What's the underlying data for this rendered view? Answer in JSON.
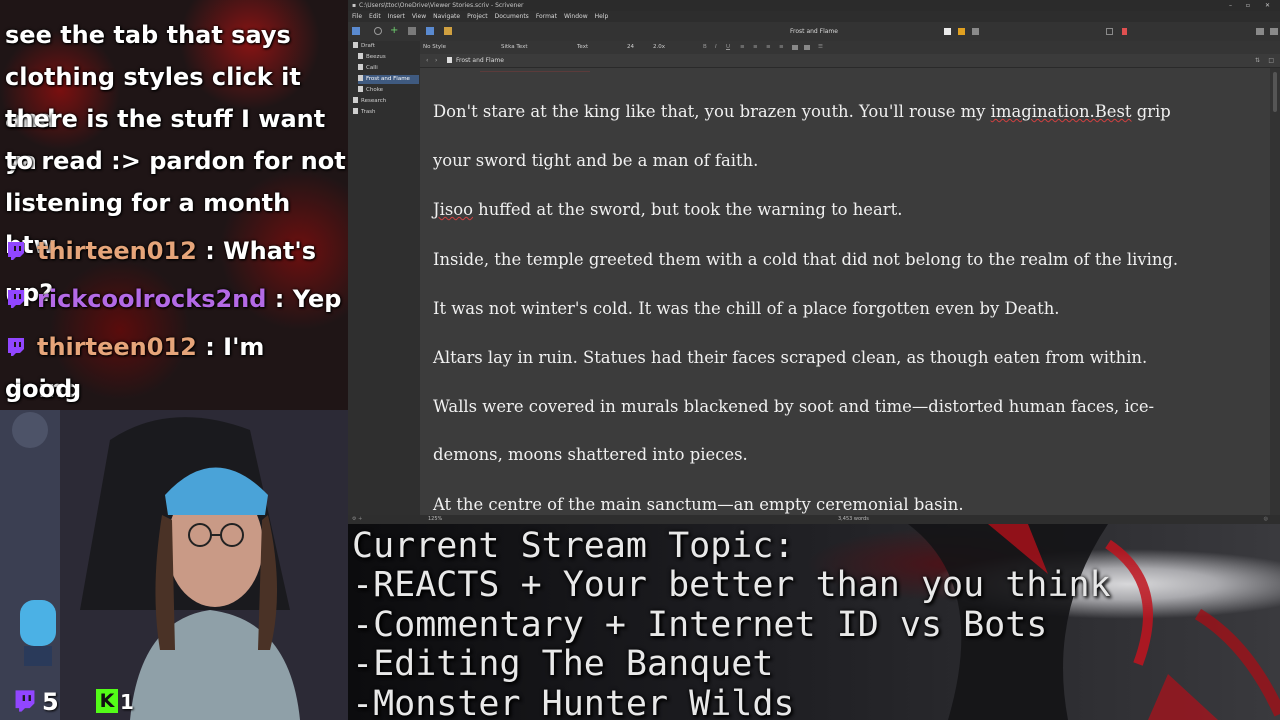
{
  "chat": {
    "messages": [
      {
        "text": "see the tab that says"
      },
      {
        "text": "clothing styles click it and"
      },
      {
        "text": "there is the stuff I want ya"
      },
      {
        "text": "to read :> pardon for not"
      },
      {
        "text": "listening for a month btw"
      },
      {
        "user": "thirteen012",
        "sep": " : ",
        "text": "What's up?"
      },
      {
        "user": "rickcoolrocks2nd",
        "sep": " : ",
        "text": "Yep"
      },
      {
        "user": "thirteen012",
        "sep": " : ",
        "text": "I'm doing"
      },
      {
        "text": "good"
      }
    ]
  },
  "badges": {
    "twitch_count": "5",
    "kick_count": "1"
  },
  "scrivener": {
    "window_title": "C:\\Users\\ttoc\\OneDrive\\Viewer Stories.scriv - Scrivener",
    "menu": [
      "File",
      "Edit",
      "Insert",
      "View",
      "Navigate",
      "Project",
      "Documents",
      "Format",
      "Window",
      "Help"
    ],
    "toolbar_doc_title": "Frost and Flame",
    "binder": [
      {
        "label": "Draft",
        "indent": 0
      },
      {
        "label": "Beezus",
        "indent": 1
      },
      {
        "label": "Calli",
        "indent": 1
      },
      {
        "label": "Frost and Flame",
        "indent": 1,
        "selected": true
      },
      {
        "label": "Choke",
        "indent": 1
      },
      {
        "label": "Research",
        "indent": 0
      },
      {
        "label": "Trash",
        "indent": 0
      }
    ],
    "format": {
      "style": "No Style",
      "font": "Sitka Text",
      "face": "Text",
      "size": "24",
      "spacing": "2.0x"
    },
    "doc_header_title": "Frost and Flame",
    "zoom": "125%",
    "word_count": "3,453 words",
    "paragraphs": [
      [
        "Don't stare at the king like that, you brazen youth. You'll rouse my ",
        "imagination.Best",
        " grip"
      ],
      [
        "your sword tight and be a man of faith.",
        "",
        ""
      ],
      [
        "",
        "Jisoo",
        " huffed at the sword, but took the warning to heart."
      ],
      [
        "Inside, the temple greeted them with a cold that did not belong to the realm of the living.",
        "",
        ""
      ],
      [
        "It was not winter's cold. It was the chill of a place forgotten even by Death.",
        "",
        ""
      ],
      [
        "Altars lay in ruin. Statues had their faces scraped clean, as though eaten from within.",
        "",
        ""
      ],
      [
        "Walls were covered in murals blackened by soot and time—distorted human faces, ice-",
        "",
        ""
      ],
      [
        "demons, moons shattered into pieces.",
        "",
        ""
      ],
      [
        "At the centre of the main sanctum—an empty ceremonial basin.",
        "",
        ""
      ]
    ]
  },
  "stream_topic": {
    "lines": [
      "Current Stream Topic:",
      "-REACTS + Your better than you think",
      "-Commentary + Internet ID vs Bots",
      "-Editing The Banquet",
      "-Monster Hunter Wilds"
    ]
  },
  "colors": {
    "user_thirteen": "#e6a57a",
    "user_rick": "#b46ae6",
    "twitch_purple": "#9146ff",
    "kick_green": "#53fc18",
    "editor_bg": "#3c3c3c"
  },
  "icons": [
    "twitch-chat-icon",
    "twitch-logo-icon",
    "kick-logo-icon",
    "binder-folder-icon",
    "binder-document-icon"
  ]
}
